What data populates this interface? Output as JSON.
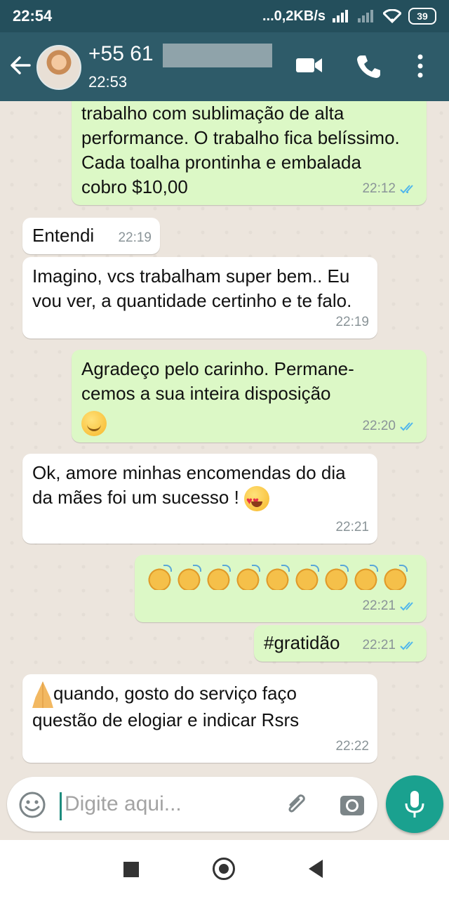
{
  "status_bar": {
    "time": "22:54",
    "network_speed": "...0,2KB/s",
    "battery": "39"
  },
  "header": {
    "contact_name": "+55 61",
    "contact_status": "22:53"
  },
  "messages": [
    {
      "dir": "out",
      "text": "trabalho com sublimação de alta performance. O trabalho fica belíssimo. Cada toalha prontinha e embalada cobro $10,00",
      "time": "22:12"
    },
    {
      "dir": "in",
      "text": "Entendi",
      "time": "22:19"
    },
    {
      "dir": "in",
      "text": "Imagino, vcs trabalham super bem.. Eu vou ver, a quantidade certinho e te falo.",
      "time": "22:19"
    },
    {
      "dir": "out",
      "text": "Agradeço pelo carinho. Permane-cemos a sua inteira disposição",
      "emoji": "smiling-face",
      "time": "22:20"
    },
    {
      "dir": "in",
      "text": "Ok, amore minhas encomendas do dia da mães foi um sucesso !",
      "emoji": "heart-eyes",
      "time": "22:21"
    },
    {
      "dir": "out",
      "emoji": "clapping-hands",
      "emoji_count": 9,
      "time": "22:21"
    },
    {
      "dir": "out",
      "text": "#gratidão",
      "time": "22:21"
    },
    {
      "dir": "in",
      "text": "quando, gosto do serviço faço questão de elogiar e indicar Rsrs",
      "emoji": "folded-hands",
      "time": "22:22"
    }
  ],
  "input": {
    "placeholder": "Digite aqui..."
  },
  "colors": {
    "header": "#2e5b69",
    "status_bar": "#244f5c",
    "outgoing_bubble": "#dcf8c6",
    "incoming_bubble": "#ffffff",
    "chat_background": "#ece5dd",
    "read_ticks": "#4fb6ec",
    "mic_button": "#1aa18f"
  }
}
